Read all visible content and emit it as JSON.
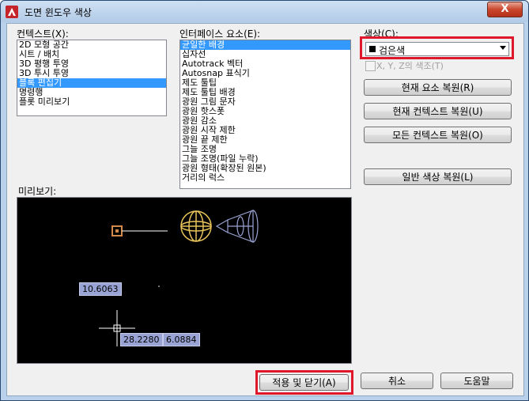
{
  "window": {
    "title": "도면 윈도우 색상",
    "close_label": "X"
  },
  "context": {
    "label": "컨텍스트(X):",
    "items": [
      "2D 모형 공간",
      "시트 / 배치",
      "3D 평행 투영",
      "3D 투시 투영",
      "블록 편집기",
      "명령행",
      "플롯 미리보기"
    ],
    "selected_index": 4
  },
  "interface": {
    "label": "인터페이스 요소(E):",
    "items": [
      "균일한 배경",
      "십자선",
      "Autotrack 벡터",
      "Autosnap 표식기",
      "제도 툴팁",
      "제도 툴팁 배경",
      "광원 그림 문자",
      "광원 핫스폿",
      "광원 감소",
      "광원 시작 제한",
      "광원 끝 제한",
      "그늘 조명",
      "그늘 조명(파일 누락)",
      "광원 형태(확장된 원본)",
      "거리의 럭스"
    ],
    "selected_index": 0
  },
  "color": {
    "label": "색상(C):",
    "value": "검은색",
    "swatch": "#000000",
    "tint_checkbox_label": "X, Y, Z의 색조(T)",
    "tint_checked": false
  },
  "buttons": {
    "restore_current_element": "현재 요소 복원(R)",
    "restore_current_context": "현재 컨텍스트 복원(U)",
    "restore_all_contexts": "모든 컨텍스트 복원(O)",
    "restore_classic": "일반 색상 복원(L)",
    "apply_close": "적용 및 닫기(A)",
    "cancel": "취소",
    "help": "도움말"
  },
  "preview": {
    "label": "미리보기:",
    "dim_1": "10.6063",
    "dim_2": "28.2280",
    "dim_3": "6.0884",
    "accent_color": "#e8c35a",
    "highlight_color": "#e0162b"
  }
}
